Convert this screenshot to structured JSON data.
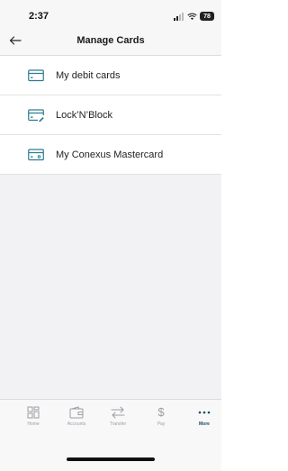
{
  "status_bar": {
    "time": "2:37",
    "battery": "78"
  },
  "header": {
    "title": "Manage Cards",
    "back_icon": "arrow-left-icon"
  },
  "menu": {
    "items": [
      {
        "label": "My debit cards",
        "icon": "card-icon"
      },
      {
        "label": "Lock’N’Block",
        "icon": "card-lock-icon"
      },
      {
        "label": "My Conexus Mastercard",
        "icon": "credit-card-icon"
      }
    ]
  },
  "tab_bar": {
    "tabs": [
      {
        "label": "Home",
        "icon": "grid-icon",
        "active": false
      },
      {
        "label": "Accounts",
        "icon": "wallet-icon",
        "active": false
      },
      {
        "label": "Transfer",
        "icon": "transfer-arrows-icon",
        "active": false
      },
      {
        "label": "Pay",
        "icon": "dollar-icon",
        "active": false
      },
      {
        "label": "More",
        "icon": "more-dots-icon",
        "active": true
      }
    ]
  },
  "colors": {
    "accent": "#174a66",
    "icon_teal": "#2b7d91",
    "background": "#f2f2f4",
    "tab_inactive": "#9a9ea4"
  }
}
